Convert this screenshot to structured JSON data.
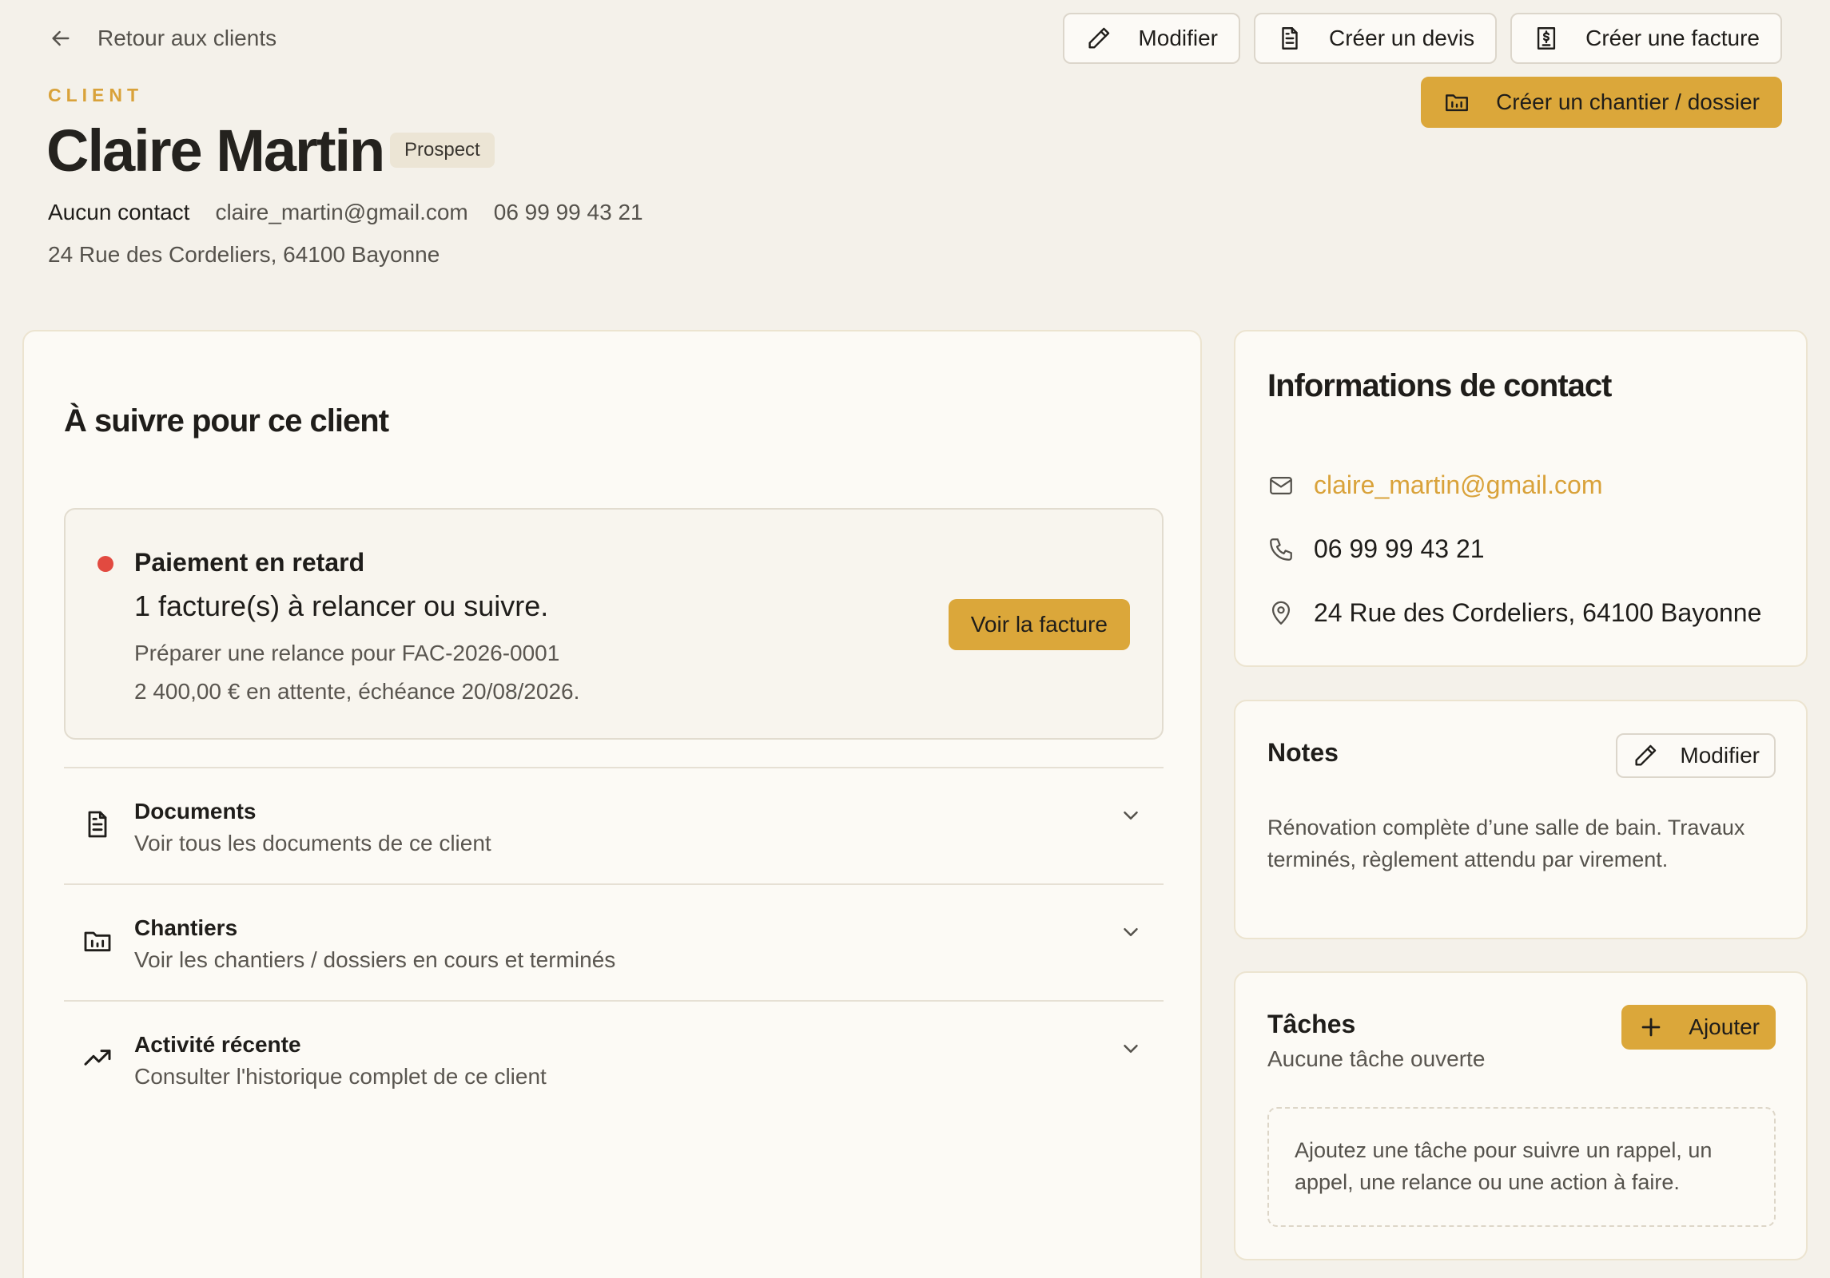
{
  "nav": {
    "back_label": "Retour aux clients"
  },
  "actions": {
    "edit": "Modifier",
    "create_quote": "Créer un devis",
    "create_invoice": "Créer une facture",
    "create_site": "Créer un chantier / dossier"
  },
  "client": {
    "eyebrow": "CLIENT",
    "name": "Claire Martin",
    "status": "Prospect",
    "contact": "Aucun contact",
    "email": "claire_martin@gmail.com",
    "phone": "06 99 99 43 21",
    "address": "24 Rue des Cordeliers, 64100 Bayonne"
  },
  "follow_up": {
    "title": "À suivre pour ce client",
    "alert": {
      "title": "Paiement en retard",
      "headline": "1 facture(s) à relancer ou suivre.",
      "detail_1": "Préparer une relance pour FAC-2026-0001",
      "detail_2": "2 400,00 € en attente, échéance 20/08/2026.",
      "button": "Voir la facture"
    },
    "sections": [
      {
        "title": "Documents",
        "subtitle": "Voir tous les documents de ce client"
      },
      {
        "title": "Chantiers",
        "subtitle": "Voir les chantiers / dossiers en cours et terminés"
      },
      {
        "title": "Activité récente",
        "subtitle": "Consulter l'historique complet de ce client"
      }
    ]
  },
  "contact_info": {
    "title": "Informations de contact",
    "email": "claire_martin@gmail.com",
    "phone": "06 99 99 43 21",
    "address": "24 Rue des Cordeliers, 64100 Bayonne"
  },
  "notes": {
    "title": "Notes",
    "edit": "Modifier",
    "text": "Rénovation complète d’une salle de bain. Travaux terminés, règlement attendu par virement."
  },
  "tasks": {
    "title": "Tâches",
    "subtitle": "Aucune tâche ouverte",
    "add": "Ajouter",
    "empty": "Ajoutez une tâche pour suivre un rappel, un appel, une relance ou une action à faire."
  },
  "colors": {
    "accent": "#dba73a",
    "accent_text": "#d9a23a",
    "alert_dot": "#e24a40",
    "background": "#f4f1ea",
    "card": "#fcfaf5"
  },
  "icons": {
    "back": "arrow-left-icon",
    "edit": "pencil-icon",
    "quote": "document-icon",
    "invoice": "invoice-icon",
    "site": "folder-icon",
    "documents": "document-icon",
    "sites": "folder-icon",
    "activity": "trending-up-icon",
    "expand": "chevron-down-icon",
    "email": "mail-icon",
    "phone": "phone-icon",
    "address": "map-pin-icon",
    "add": "plus-icon"
  }
}
